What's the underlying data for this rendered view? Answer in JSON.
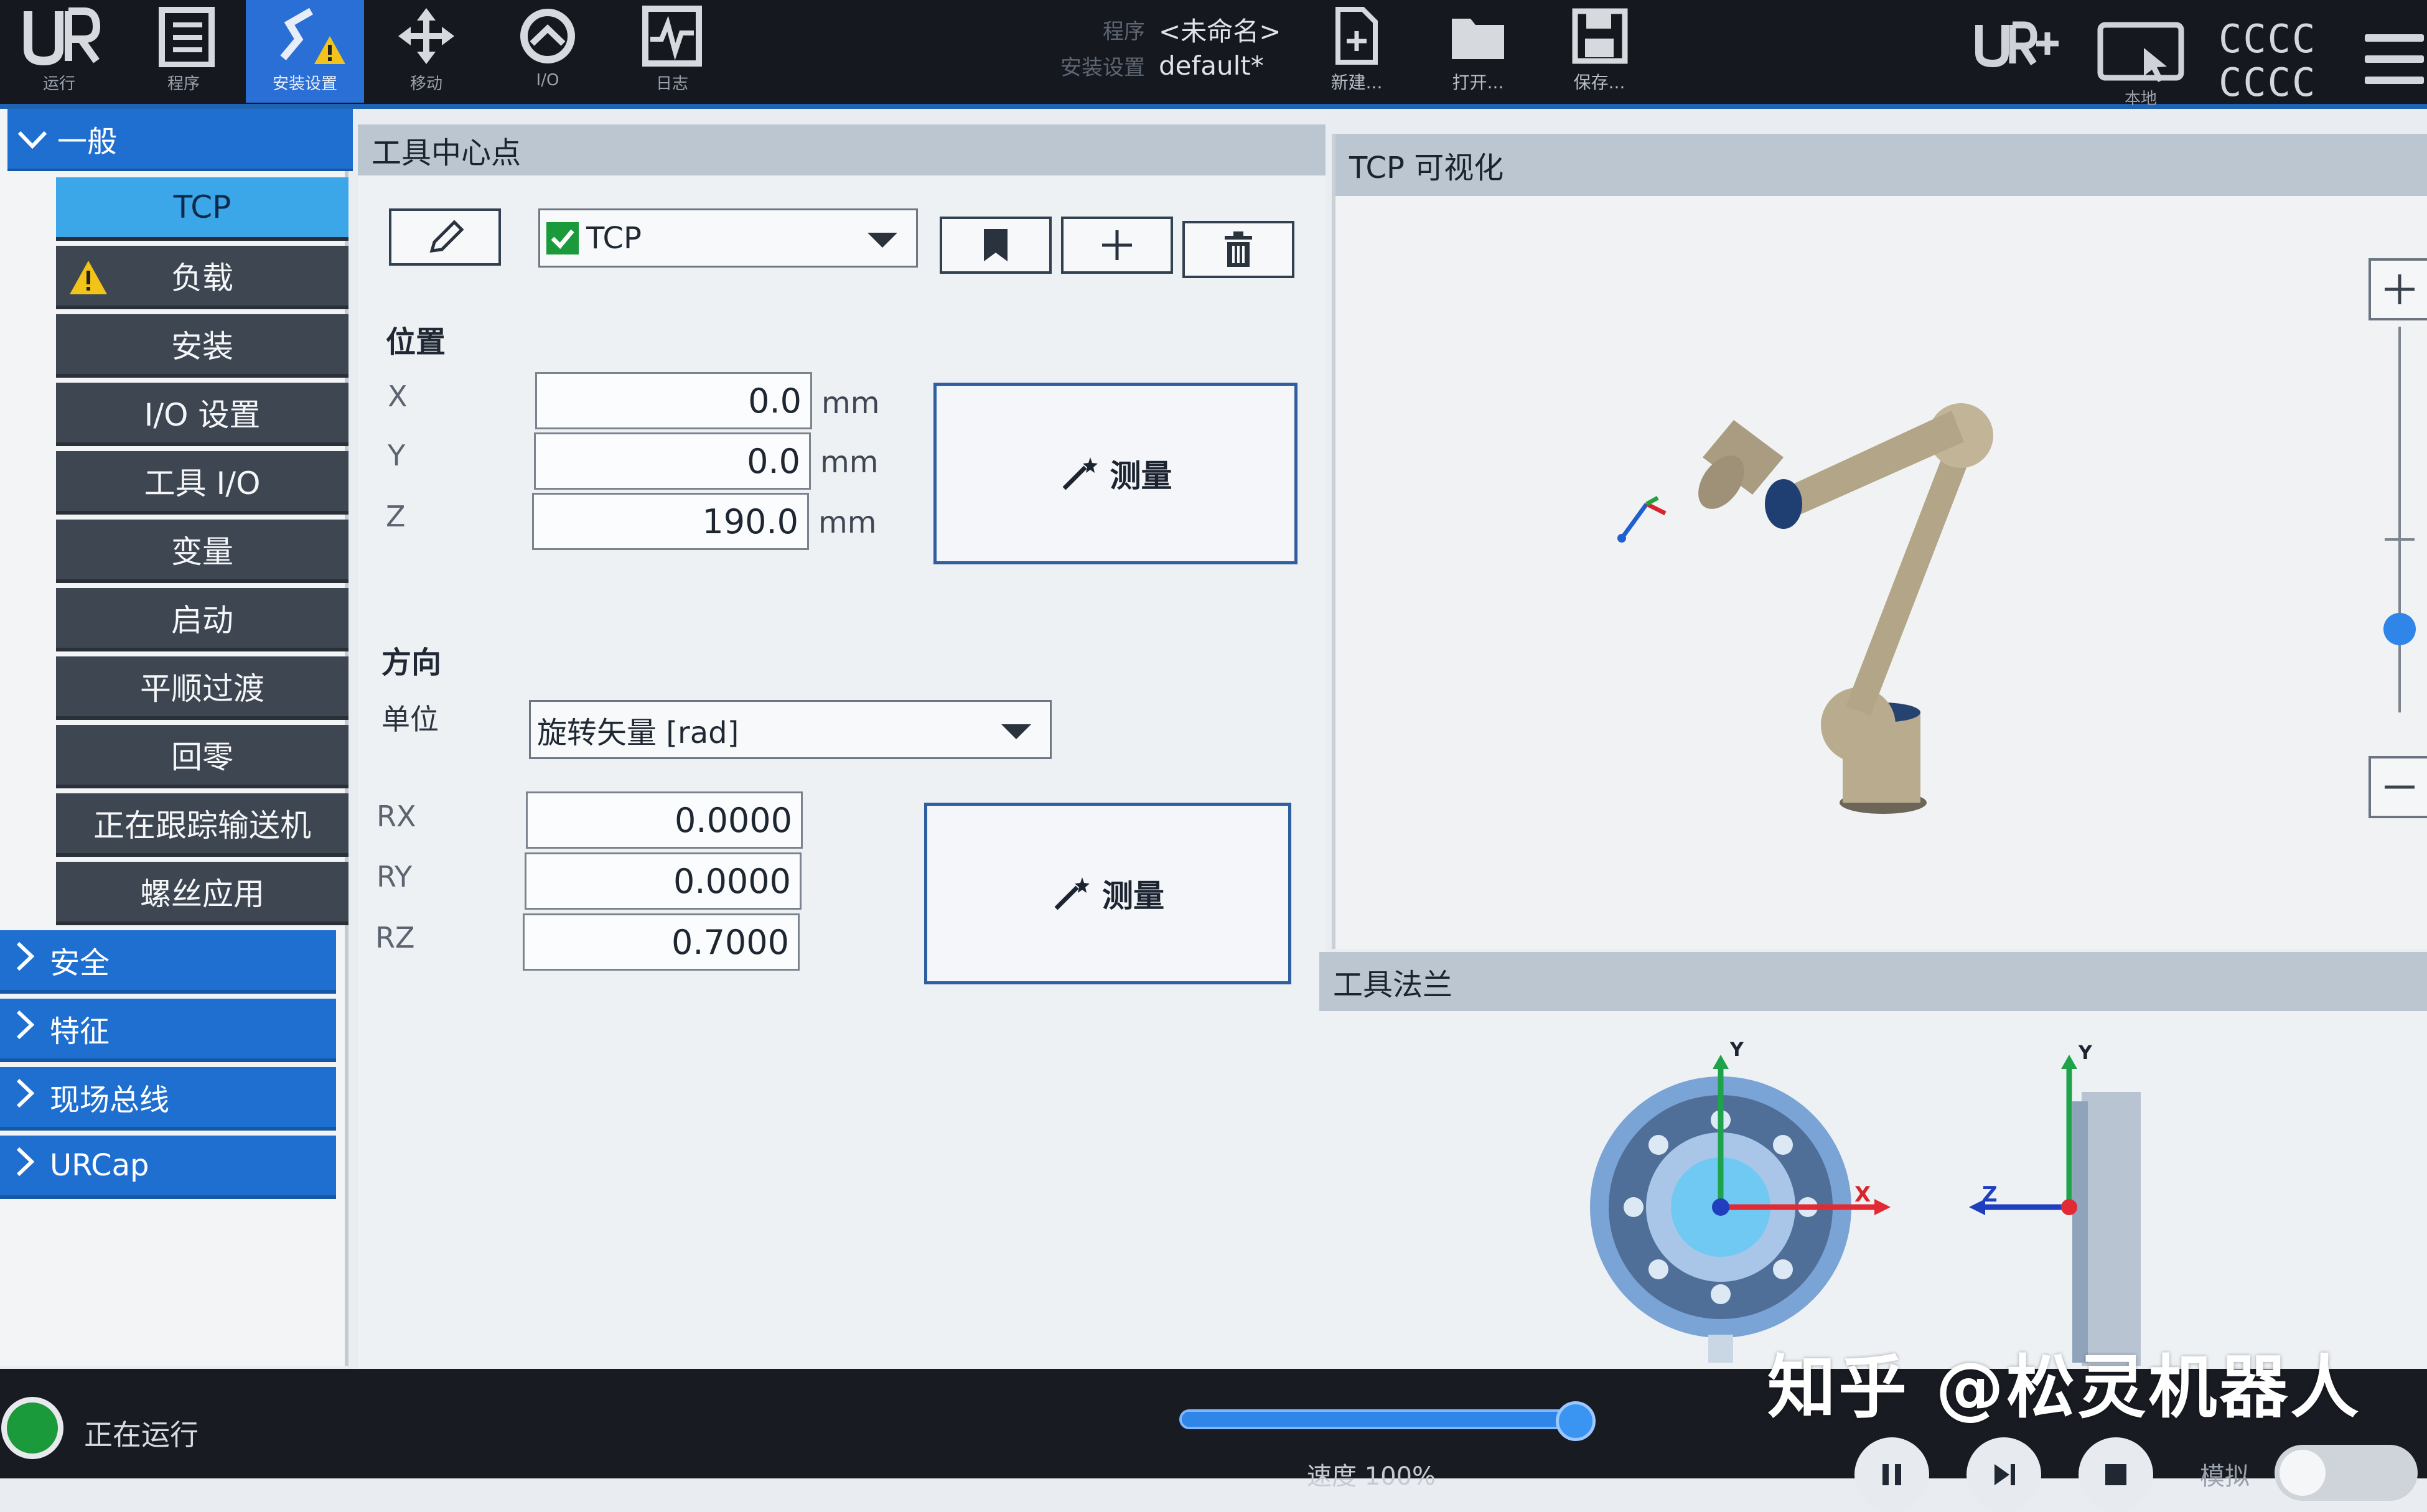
{
  "topbar": {
    "nav": [
      {
        "label": "运行",
        "icon": "ur-logo-icon"
      },
      {
        "label": "程序",
        "icon": "program-icon"
      },
      {
        "label": "安装设置",
        "icon": "installation-warning-icon"
      },
      {
        "label": "移动",
        "icon": "move-icon"
      },
      {
        "label": "I/O",
        "icon": "io-icon"
      },
      {
        "label": "日志",
        "icon": "log-icon"
      }
    ],
    "program_key": "程序",
    "program_name": "<未命名>",
    "installation_key": "安装设置",
    "installation_name": "default*",
    "file_buttons": {
      "new": "新建...",
      "open": "打开...",
      "save": "保存..."
    },
    "local_label": "本地",
    "status_rows": [
      "CCCC",
      "CCCC"
    ]
  },
  "sidebar": {
    "general_label": "一般",
    "items": [
      {
        "label": "TCP",
        "selected": true
      },
      {
        "label": "负载",
        "warning": true
      },
      {
        "label": "安装"
      },
      {
        "label": "I/O 设置"
      },
      {
        "label": "工具 I/O"
      },
      {
        "label": "变量"
      },
      {
        "label": "启动"
      },
      {
        "label": "平顺过渡"
      },
      {
        "label": "回零"
      },
      {
        "label": "正在跟踪输送机"
      },
      {
        "label": "螺丝应用"
      }
    ],
    "sections": [
      "安全",
      "特征",
      "现场总线",
      "URCap"
    ]
  },
  "tcp": {
    "title": "工具中心点",
    "tcp_select_value": "TCP",
    "position_label": "位置",
    "x_label": "X",
    "x_value": "0.0",
    "y_label": "Y",
    "y_value": "0.0",
    "z_label": "Z",
    "z_value": "190.0",
    "unit_mm": "mm",
    "measure_label": "测量",
    "orientation_label": "方向",
    "unit_label": "单位",
    "unit_select_value": "旋转矢量 [rad]",
    "rx_label": "RX",
    "rx_value": "0.0000",
    "ry_label": "RY",
    "ry_value": "0.0000",
    "rz_label": "RZ",
    "rz_value": "0.7000"
  },
  "viz": {
    "title": "TCP 可视化",
    "flange_title": "工具法兰",
    "axis_labels": {
      "x": "X",
      "y": "Y",
      "z": "Z"
    }
  },
  "bottombar": {
    "status_text": "正在运行",
    "speed_label": "速度 100%",
    "speed_fraction": 0.93,
    "sim_label": "模拟"
  },
  "watermark": "知乎 @松灵机器人",
  "colors": {
    "accent_blue": "#1f6fd0",
    "selected_cyan": "#3ca7e8",
    "dark_bg": "#15181e",
    "run_green": "#1a9a3a",
    "warning_yellow": "#f2c318"
  }
}
